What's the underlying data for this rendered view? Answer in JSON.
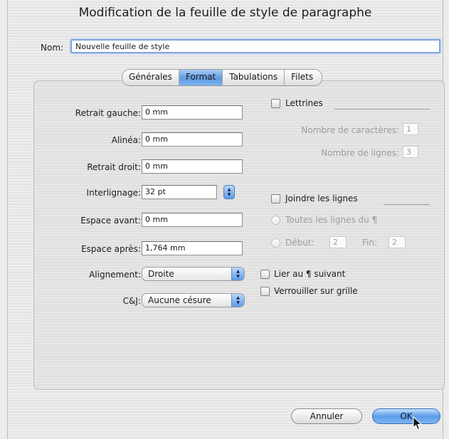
{
  "dialog": {
    "title": "Modification de la feuille de style de paragraphe"
  },
  "name_field": {
    "label": "Nom:",
    "value": "Nouvelle feuille de style"
  },
  "tabs": [
    {
      "label": "Générales",
      "active": false
    },
    {
      "label": "Format",
      "active": true
    },
    {
      "label": "Tabulations",
      "active": false
    },
    {
      "label": "Filets",
      "active": false
    }
  ],
  "format": {
    "retrait_gauche": {
      "label": "Retrait gauche:",
      "value": "0 mm"
    },
    "alinea": {
      "label": "Alinéa:",
      "value": "0 mm"
    },
    "retrait_droit": {
      "label": "Retrait droit:",
      "value": "0 mm"
    },
    "interlignage": {
      "label": "Interlignage:",
      "value": "32 pt"
    },
    "espace_avant": {
      "label": "Espace avant:",
      "value": "0 mm"
    },
    "espace_apres": {
      "label": "Espace après:",
      "value": "1,764 mm"
    },
    "alignement": {
      "label": "Alignement:",
      "value": "Droite"
    },
    "cj": {
      "label": "C&J:",
      "value": "Aucune césure"
    }
  },
  "lettrines": {
    "label": "Lettrines",
    "checked": false,
    "nb_caracteres": {
      "label": "Nombre de caractères:",
      "value": "1"
    },
    "nb_lignes": {
      "label": "Nombre de lignes:",
      "value": "3"
    }
  },
  "joindre": {
    "label": "Joindre les lignes",
    "checked": false,
    "toutes": {
      "label": "Toutes les lignes du ¶"
    },
    "debut": {
      "label": "Début:",
      "value": "2"
    },
    "fin": {
      "label": "Fin:",
      "value": "2"
    }
  },
  "options": {
    "lier": {
      "label": "Lier au ¶ suivant",
      "checked": false
    },
    "verrouiller": {
      "label": "Verrouiller sur grille",
      "checked": false
    }
  },
  "buttons": {
    "cancel": "Annuler",
    "ok": "OK"
  },
  "colors": {
    "accent": "#5f9be3",
    "focus_ring": "#7fa6e0"
  }
}
